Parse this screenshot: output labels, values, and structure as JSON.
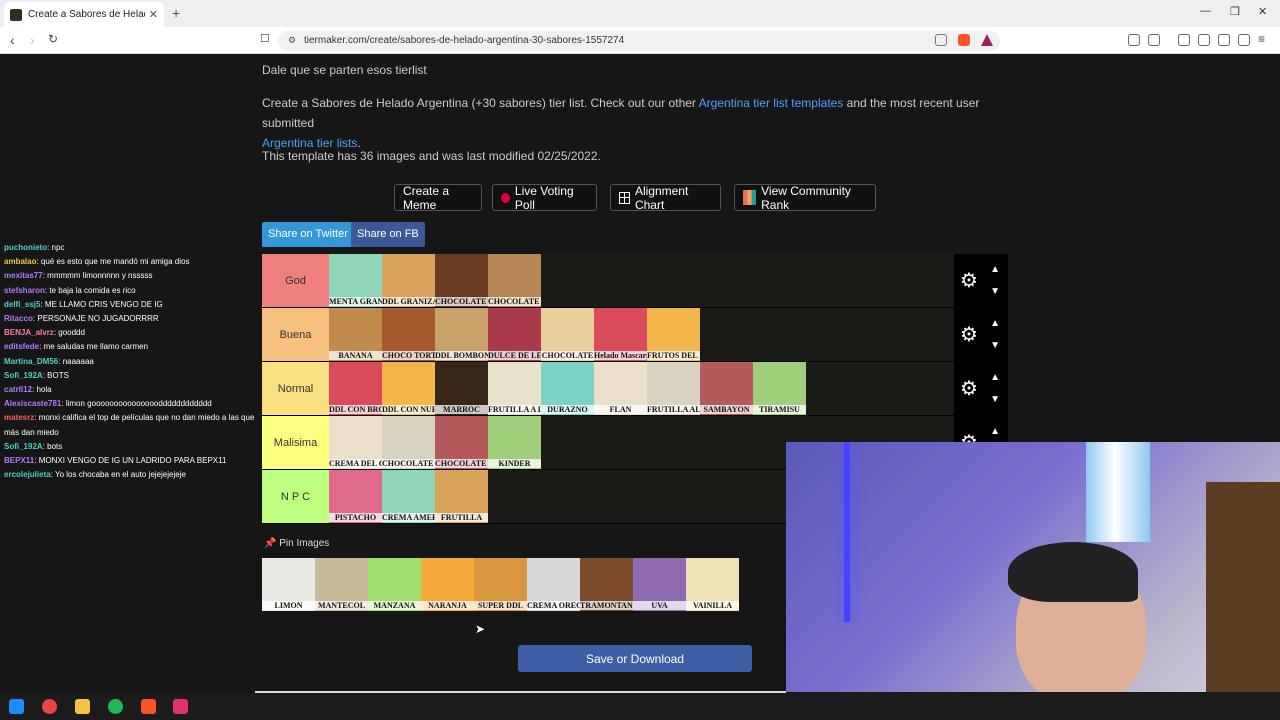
{
  "browser": {
    "tab_title": "Create a Sabores de Helado Arg",
    "url": "tiermaker.com/create/sabores-de-helado-argentina-30-sabores-1557274"
  },
  "page": {
    "tagline": "Dale que se parten esos tierlist",
    "intro_1": "Create a Sabores de Helado Argentina (+30 sabores) tier list. Check out our other ",
    "intro_link_1": "Argentina tier list templates",
    "intro_2": " and the most recent user submitted",
    "intro_link_2": "Argentina tier lists",
    "intro_3": ".",
    "template_info": "This template has 36 images and was last modified 02/25/2022."
  },
  "actions": {
    "create_meme": "Create a Meme",
    "live_voting": "Live Voting Poll",
    "alignment_chart": "Alignment Chart",
    "community_rank": "View Community Rank",
    "share_twitter": "Share on Twitter",
    "share_fb": "Share on FB"
  },
  "tiers": [
    {
      "label": "God",
      "color": "#f07f7f",
      "items": [
        "MENTA GRANIZADA",
        "DDL GRANIZADO",
        "CHOCOLATE SUIZO",
        "CHOCOLATE CON ALMENDRAS"
      ]
    },
    {
      "label": "Buena",
      "color": "#f7bf80",
      "items": [
        "BANANA",
        "CHOCO TORTA",
        "DDL BOMBON",
        "DULCE DE LECHE",
        "CHOCOLATE",
        "Helado Mascarpone",
        "FRUTOS DEL BOSQUE"
      ]
    },
    {
      "label": "Normal",
      "color": "#f8df80",
      "items": [
        "DDL CON BROWNIE",
        "DDL CON NUEZ",
        "MARROC",
        "FRUTILLA A LA REINA",
        "DURAZNO",
        "FLAN",
        "FRUTILLA AL AGUA",
        "SAMBAYON",
        "TIRAMISU"
      ]
    },
    {
      "label": "Malisima",
      "color": "#fdff7f",
      "items": [
        "CREMA DEL CIELO",
        "CHOCOLATE BLANCO",
        "CHOCOLATE AL WHISKY",
        "KINDER"
      ]
    },
    {
      "label": "N P C",
      "color": "#bfff7f",
      "items": [
        "PISTACHO",
        "CREMA AMERICANA",
        "FRUTILLA"
      ]
    }
  ],
  "pin_title": "Pin Images",
  "pinned": [
    "LIMON",
    "MANTECOL",
    "MANZANA",
    "NARANJA",
    "SUPER DDL",
    "CREMA OREO",
    "TRAMONTANA",
    "UVA",
    "VAINILLA"
  ],
  "save_label": "Save or Download",
  "chat": [
    {
      "user": "puchonieto",
      "color": "#4fd1c5",
      "msg": ": npc"
    },
    {
      "user": "ambalao",
      "color": "#f6c343",
      "msg": ": qué es esto que me mandó mi amiga dios"
    },
    {
      "user": "mexitas77",
      "color": "#b07cff",
      "msg": ": mmmmm limonnnnn y nsssss"
    },
    {
      "user": "stefsharon",
      "color": "#b07cff",
      "msg": ": te baja la comida es rico"
    },
    {
      "user": "delfi_ssj5",
      "color": "#4fd1c5",
      "msg": ": ME LLAMO CRIS VENGO DE IG"
    },
    {
      "user": "Ritacco",
      "color": "#b07cff",
      "msg": ": PERSONAJE NO JUGADORRRR"
    },
    {
      "user": "BENJA_alvrz",
      "color": "#ff7ab6",
      "msg": ": gooddd"
    },
    {
      "user": "editsfede",
      "color": "#b07cff",
      "msg": ": me saludas me llamo carmen"
    },
    {
      "user": "Martina_DM56",
      "color": "#4fd1c5",
      "msg": ": naaaaaa"
    },
    {
      "user": "Sofi_192A",
      "color": "#4fd1c5",
      "msg": ": BOTS"
    },
    {
      "user": "catrll12",
      "color": "#b07cff",
      "msg": ": hola"
    },
    {
      "user": "Alexiscaste781",
      "color": "#b07cff",
      "msg": ": limon gooooooooooooooodddddddddddd"
    },
    {
      "user": "matesrz",
      "color": "#ff5f5f",
      "msg": ": monxi califica el top de películas que no dan miedo a las que más dan miedo"
    },
    {
      "user": "Sofi_192A",
      "color": "#4fd1c5",
      "msg": ": bots"
    },
    {
      "user": "BEPX11",
      "color": "#b07cff",
      "msg": ": MONXI VENGO DE IG UN LADRIDO PARA BEPX11"
    },
    {
      "user": "ercolejulieta",
      "color": "#4fd1c5",
      "msg": ": Yo los chocaba en el auto jejejejejeje"
    }
  ]
}
